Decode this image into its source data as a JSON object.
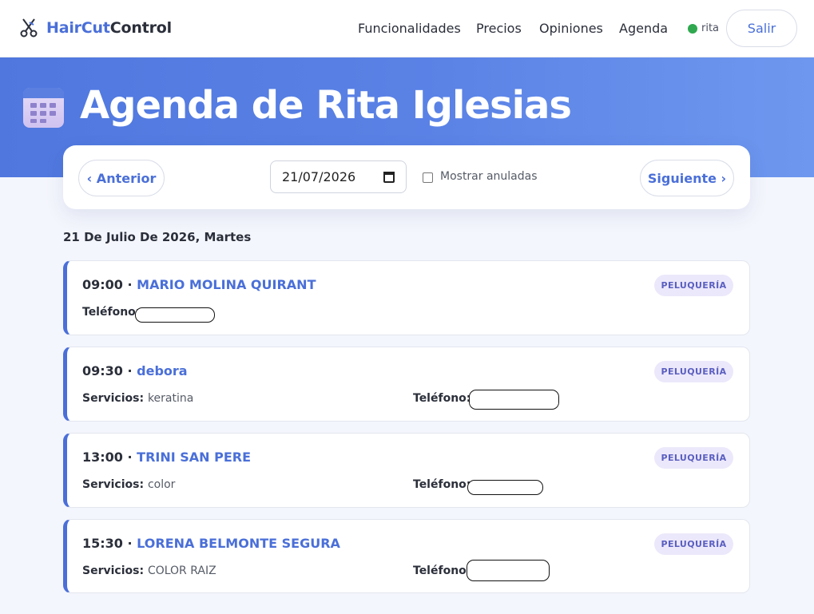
{
  "brand": {
    "part1": "HairCut",
    "part2": "Control"
  },
  "nav": {
    "links": [
      "Funcionalidades",
      "Precios",
      "Opiniones",
      "Agenda"
    ],
    "user": "rita",
    "logout": "Salir"
  },
  "hero": {
    "title": "Agenda de Rita Iglesias"
  },
  "controls": {
    "prev": "‹ Anterior",
    "next": "Siguiente ›",
    "date": "21/07/2026",
    "show_cancelled": "Mostrar anuladas"
  },
  "date_heading": "21 De Julio De 2026, Martes",
  "labels": {
    "services": "Servicios:",
    "phone": "Teléfono:"
  },
  "appointments": [
    {
      "time": "09:00 · ",
      "client": "MARIO MOLINA QUIRANT",
      "badge": "PELUQUERÍA",
      "services": ""
    },
    {
      "time": "09:30 · ",
      "client": "debora",
      "badge": "PELUQUERÍA",
      "services": "keratina"
    },
    {
      "time": "13:00 · ",
      "client": "TRINI SAN PERE",
      "badge": "PELUQUERÍA",
      "services": "color"
    },
    {
      "time": "15:30 · ",
      "client": "LORENA BELMONTE SEGURA",
      "badge": "PELUQUERÍA",
      "services": "COLOR RAIZ"
    }
  ],
  "colors": {
    "accent": "#4a6fd8",
    "status_online": "#2fa84f",
    "badge_bg": "#ece8fb"
  }
}
